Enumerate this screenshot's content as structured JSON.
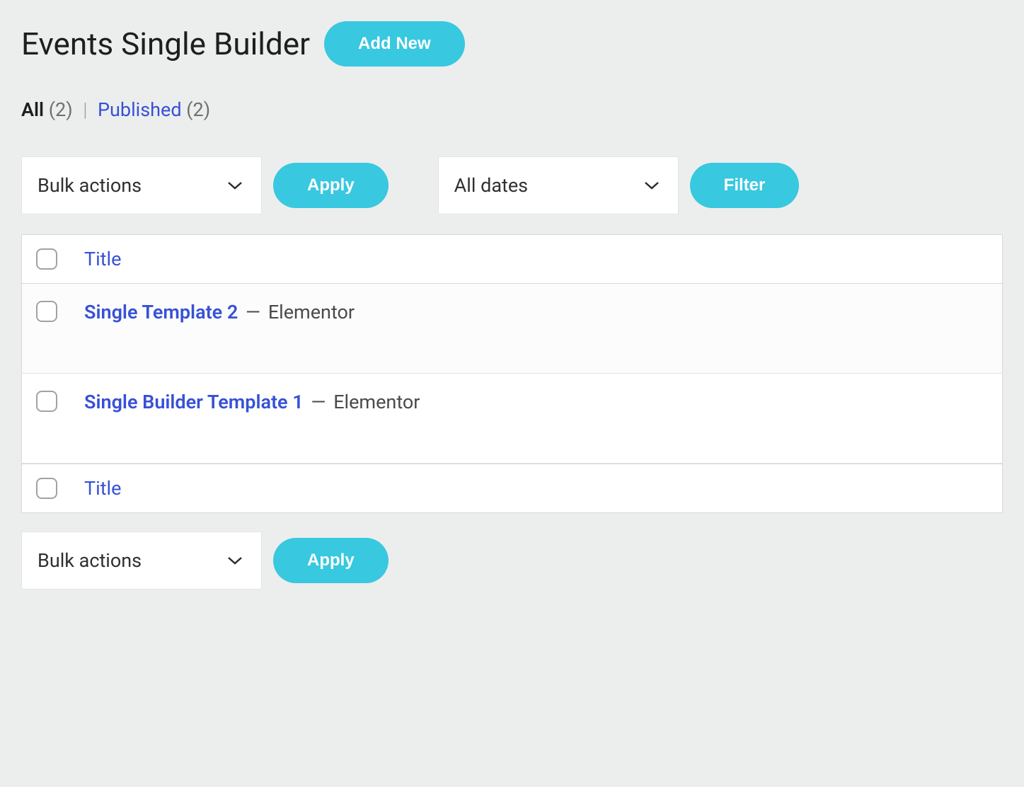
{
  "header": {
    "title": "Events Single Builder",
    "add_new": "Add New"
  },
  "status_filter": {
    "all_label": "All",
    "all_count": "(2)",
    "separator": "|",
    "published_label": "Published",
    "published_count": "(2)"
  },
  "top_actions": {
    "bulk_select": "Bulk actions",
    "apply": "Apply",
    "date_select": "All dates",
    "filter": "Filter"
  },
  "table": {
    "header_title": "Title",
    "footer_title": "Title",
    "rows": [
      {
        "title": "Single Template 2",
        "dash": "—",
        "meta": "Elementor"
      },
      {
        "title": "Single Builder Template 1",
        "dash": "—",
        "meta": "Elementor"
      }
    ]
  },
  "bottom_actions": {
    "bulk_select": "Bulk actions",
    "apply": "Apply"
  }
}
